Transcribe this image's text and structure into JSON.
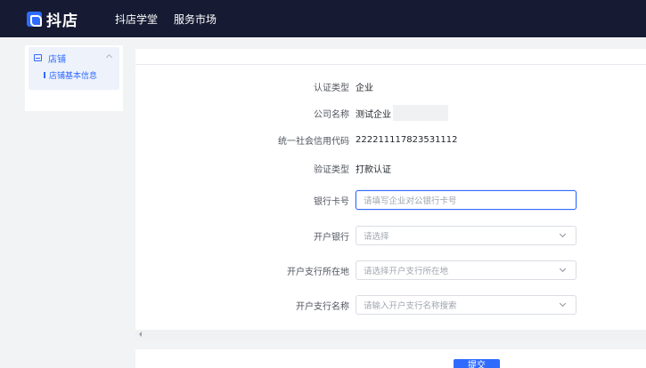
{
  "header": {
    "logo_text": "抖店",
    "nav": [
      "抖店学堂",
      "服务市场"
    ]
  },
  "sidebar": {
    "group_label": "店铺",
    "items": [
      "店铺基本信息"
    ]
  },
  "form": {
    "cert_type": {
      "label": "认证类型",
      "value": "企业"
    },
    "company_name": {
      "label": "公司名称",
      "value": "测试企业"
    },
    "credit_code": {
      "label": "统一社会信用代码",
      "value": "222211117823531112"
    },
    "verify_type": {
      "label": "验证类型",
      "value": "打款认证"
    },
    "bank_card": {
      "label": "银行卡号",
      "placeholder": "请填写企业对公银行卡号"
    },
    "bank": {
      "label": "开户银行",
      "placeholder": "请选择"
    },
    "branch_location": {
      "label": "开户支行所在地",
      "placeholder": "请选择开户支行所在地"
    },
    "branch_name": {
      "label": "开户支行名称",
      "placeholder": "请输入开户支行名称搜索"
    }
  },
  "footer": {
    "submit_label": "提交"
  },
  "colors": {
    "accent": "#2f6bff",
    "topbar": "#161b33"
  }
}
